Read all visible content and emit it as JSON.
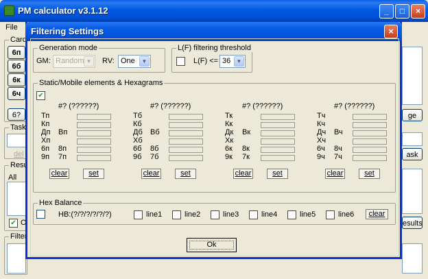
{
  "main_window": {
    "title": "PM calculator v3.1.12",
    "menu_file": "File",
    "titlebar_buttons": [
      "_",
      "□",
      "×"
    ],
    "cards_label": "Card",
    "card_buttons": [
      "6п",
      "6б",
      "6к",
      "6ч"
    ],
    "question_button": "6?",
    "tasks_label": "Task",
    "task_del_label": "del",
    "results_label": "Resu",
    "all_label": "All",
    "results_checkbox_text": "O",
    "right_button_fragment": "ge",
    "task_right_fragment": "ask",
    "results_right_fragment": "esults",
    "filter_label": "Filter"
  },
  "dialog": {
    "title": "Filtering Settings",
    "close_symbol": "×",
    "generation_mode": {
      "label": "Generation mode",
      "gm_label": "GM:",
      "gm_value": "Random",
      "rv_label": "RV:",
      "rv_value": "One"
    },
    "lf_threshold": {
      "label": "L(F) filtering threshold",
      "checked": false,
      "text": "L(F) <=",
      "value": "36"
    },
    "static_mobile": {
      "label": "Static/Mobile elements & Hexagrams",
      "checked": true,
      "check_mark": "✔",
      "columns": [
        {
          "header": "#? (??????)",
          "rows": [
            {
              "a": "Тп",
              "b": ""
            },
            {
              "a": "Кп",
              "b": ""
            },
            {
              "a": "Дп",
              "b": "Вп"
            },
            {
              "a": "Хп",
              "b": ""
            },
            {
              "a": "6п",
              "b": "8п"
            },
            {
              "a": "9п",
              "b": "7п"
            }
          ],
          "clear": "clear",
          "set": "set"
        },
        {
          "header": "#? (??????)",
          "rows": [
            {
              "a": "Тб",
              "b": ""
            },
            {
              "a": "Кб",
              "b": ""
            },
            {
              "a": "Дб",
              "b": "Вб"
            },
            {
              "a": "Хб",
              "b": ""
            },
            {
              "a": "6б",
              "b": "8б"
            },
            {
              "a": "9б",
              "b": "7б"
            }
          ],
          "clear": "clear",
          "set": "set"
        },
        {
          "header": "#? (??????)",
          "rows": [
            {
              "a": "Тк",
              "b": ""
            },
            {
              "a": "Кк",
              "b": ""
            },
            {
              "a": "Дк",
              "b": "Вк"
            },
            {
              "a": "Хк",
              "b": ""
            },
            {
              "a": "6к",
              "b": "8к"
            },
            {
              "a": "9к",
              "b": "7к"
            }
          ],
          "clear": "clear",
          "set": "set"
        },
        {
          "header": "#? (??????)",
          "rows": [
            {
              "a": "Тч",
              "b": ""
            },
            {
              "a": "Кч",
              "b": ""
            },
            {
              "a": "Дч",
              "b": "Вч"
            },
            {
              "a": "Хч",
              "b": ""
            },
            {
              "a": "6ч",
              "b": "8ч"
            },
            {
              "a": "9ч",
              "b": "7ч"
            }
          ],
          "clear": "clear",
          "set": "set"
        }
      ]
    },
    "hex_balance": {
      "label": "Hex Balance",
      "hb_text": "HB:(?/?/?/?/?/?)",
      "lines": [
        "line1",
        "line2",
        "line3",
        "line4",
        "line5",
        "line6"
      ],
      "clear": "clear"
    },
    "ok_label": "Ok"
  }
}
